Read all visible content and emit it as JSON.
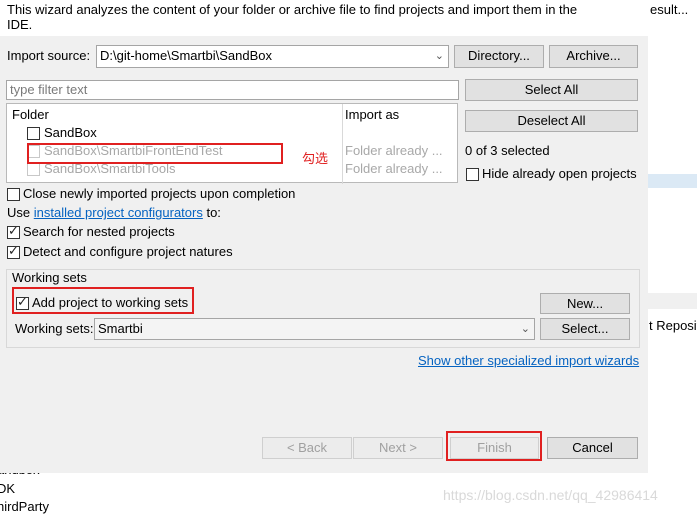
{
  "header": {
    "description": "This wizard analyzes the content of your folder or archive file to find projects and import them in the IDE."
  },
  "import_source": {
    "label": "Import source:",
    "value": "D:\\git-home\\Smartbi\\SandBox",
    "directory_button": "Directory...",
    "archive_button": "Archive..."
  },
  "filter": {
    "placeholder": "type filter text"
  },
  "table": {
    "headers": {
      "folder": "Folder",
      "import_as": "Import as"
    },
    "rows": [
      {
        "folder": "SandBox",
        "import_as": "",
        "checked": false,
        "enabled": true
      },
      {
        "folder": "SandBox\\SmartbiFrontEndTest",
        "import_as": "Folder already ...",
        "checked": false,
        "enabled": false
      },
      {
        "folder": "SandBox\\SmartbiTools",
        "import_as": "Folder already ...",
        "checked": false,
        "enabled": false
      }
    ]
  },
  "selection": {
    "select_all": "Select All",
    "deselect_all": "Deselect All",
    "count_text": "0 of 3 selected",
    "hide_open_label": "Hide already open projects"
  },
  "options": {
    "close_imported": "Close newly imported projects upon completion",
    "use_prefix": "Use",
    "configurators_link": "installed project configurators",
    "use_suffix": "to:",
    "search_nested": "Search for nested projects",
    "detect_natures": "Detect and configure project natures"
  },
  "working_sets": {
    "group_title": "Working sets",
    "add_label": "Add project to working sets",
    "new_button": "New...",
    "sets_label": "Working sets:",
    "sets_value": "Smartbi",
    "select_button": "Select..."
  },
  "wizard_link": "Show other specialized import wizards",
  "footer": {
    "back": "< Back",
    "next": "Next >",
    "finish": "Finish",
    "cancel": "Cancel"
  },
  "annotation": {
    "text": "勾选"
  },
  "background": {
    "right_top": "esult...",
    "right_mid": "t Reposit",
    "left_1": "andbox",
    "left_2": "DK",
    "left_3": "hirdParty",
    "watermark": "https://blog.csdn.net/qq_42986414"
  }
}
